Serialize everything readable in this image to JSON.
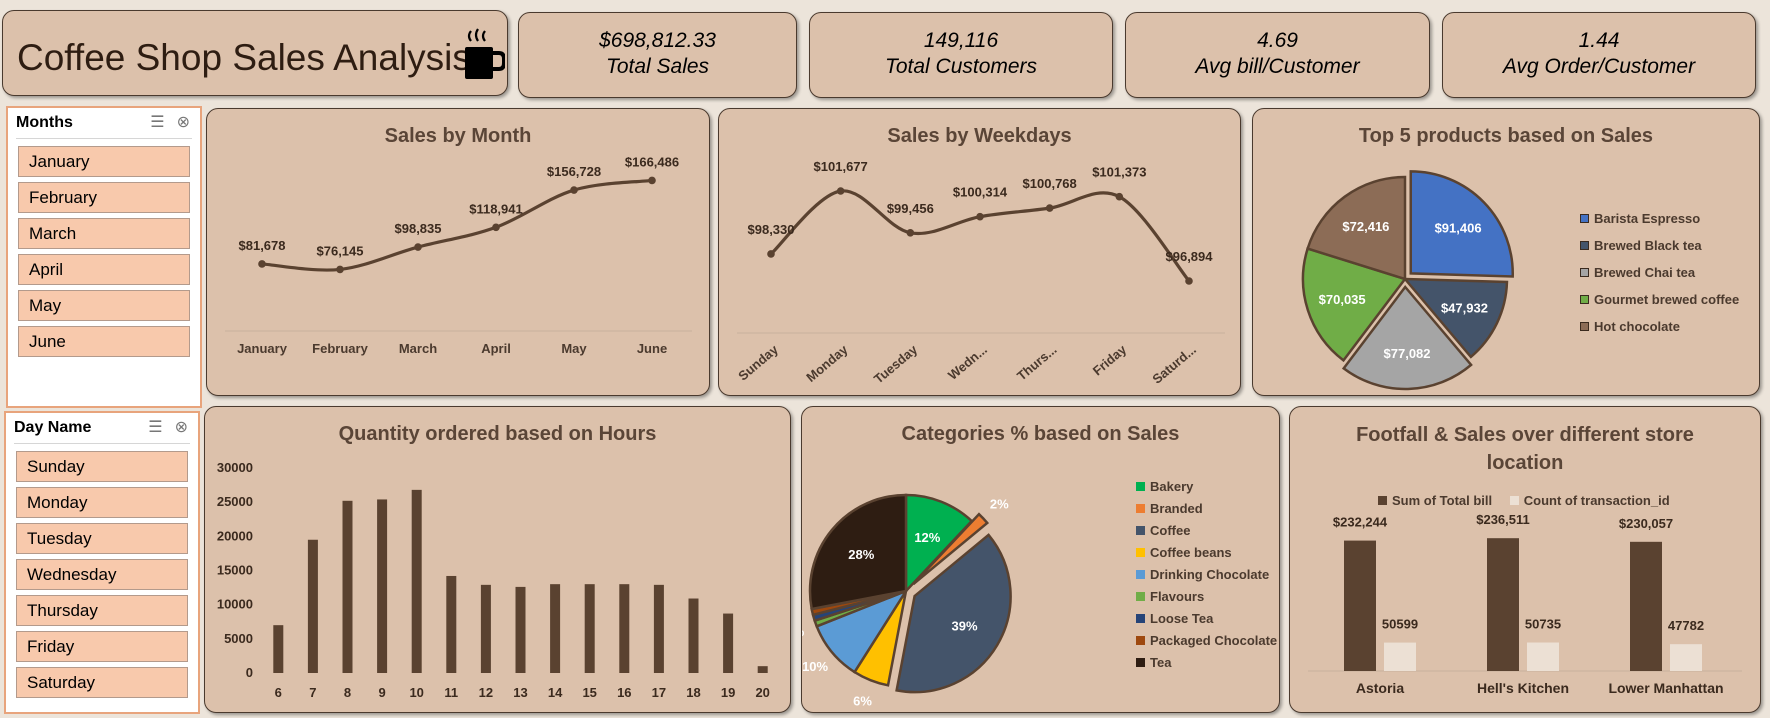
{
  "title": "Coffee Shop Sales Analysis",
  "kpis": [
    {
      "value": "$698,812.33",
      "label": "Total Sales"
    },
    {
      "value": "149,116",
      "label": "Total Customers"
    },
    {
      "value": "4.69",
      "label": "Avg bill/Customer"
    },
    {
      "value": "1.44",
      "label": "Avg Order/Customer"
    }
  ],
  "slicers": {
    "months": {
      "title": "Months",
      "items": [
        "January",
        "February",
        "March",
        "April",
        "May",
        "June"
      ]
    },
    "days": {
      "title": "Day Name",
      "items": [
        "Sunday",
        "Monday",
        "Tuesday",
        "Wednesday",
        "Thursday",
        "Friday",
        "Saturday"
      ]
    }
  },
  "colors": {
    "line": "#5a4230",
    "bar": "#5a4230",
    "bar_light": "#ece0d4",
    "card": "#dcc1ab"
  },
  "chart_data": [
    {
      "id": "month",
      "type": "line",
      "title": "Sales by Month",
      "categories": [
        "January",
        "February",
        "March",
        "April",
        "May",
        "June"
      ],
      "values": [
        81678,
        76145,
        98835,
        118941,
        156728,
        166486
      ],
      "labels": [
        "$81,678",
        "$76,145",
        "$98,835",
        "$118,941",
        "$156,728",
        "$166,486"
      ]
    },
    {
      "id": "weekday",
      "type": "line",
      "title": "Sales by Weekdays",
      "categories": [
        "Sunday",
        "Monday",
        "Tuesday",
        "Wedn...",
        "Thurs...",
        "Friday",
        "Saturd..."
      ],
      "values": [
        98330,
        101677,
        99456,
        100314,
        100768,
        101373,
        96894
      ],
      "labels": [
        "$98,330",
        "$101,677",
        "$99,456",
        "$100,314",
        "$100,768",
        "$101,373",
        "$96,894"
      ]
    },
    {
      "id": "top5",
      "type": "pie",
      "title": "Top 5 products based on Sales",
      "categories": [
        "Barista Espresso",
        "Brewed Black tea",
        "Brewed Chai tea",
        "Gourmet brewed coffee",
        "Hot chocolate"
      ],
      "values": [
        91406,
        47932,
        77082,
        70035,
        72416
      ],
      "labels": [
        "$91,406",
        "$47,932",
        "$77,082",
        "$70,035",
        "$72,416"
      ],
      "colors": [
        "#4472c4",
        "#44546a",
        "#a5a5a5",
        "#70ad47",
        "#8c6c56"
      ]
    },
    {
      "id": "hours",
      "type": "bar",
      "title": "Quantity ordered based on Hours",
      "categories": [
        "6",
        "7",
        "8",
        "9",
        "10",
        "11",
        "12",
        "13",
        "14",
        "15",
        "16",
        "17",
        "18",
        "19",
        "20"
      ],
      "values": [
        7000,
        19500,
        25200,
        25400,
        26800,
        14200,
        12900,
        12600,
        13000,
        13000,
        13000,
        12900,
        10900,
        8700,
        1000
      ],
      "ylim": [
        0,
        30000
      ],
      "yticks": [
        "0",
        "5000",
        "10000",
        "15000",
        "20000",
        "25000",
        "30000"
      ]
    },
    {
      "id": "categories",
      "type": "pie",
      "title": "Categories % based on Sales",
      "categories": [
        "Bakery",
        "Branded",
        "Coffee",
        "Coffee beans",
        "Drinking Chocolate",
        "Flavours",
        "Loose Tea",
        "Packaged Chocolate",
        "Tea"
      ],
      "values": [
        12,
        2,
        39,
        6,
        10,
        1,
        1,
        1,
        28
      ],
      "labels": [
        "12%",
        "2%",
        "39%",
        "6%",
        "10%",
        "1%",
        "1%",
        "1%",
        "28%"
      ],
      "colors": [
        "#00b050",
        "#ed7d31",
        "#44546a",
        "#ffc000",
        "#5b9bd5",
        "#70ad47",
        "#264478",
        "#9e480e",
        "#2e1d12"
      ]
    },
    {
      "id": "footfall",
      "type": "bar",
      "title": "Footfall & Sales over different store location",
      "categories": [
        "Astoria",
        "Hell's Kitchen",
        "Lower Manhattan"
      ],
      "series": [
        {
          "name": "Sum of Total bill",
          "values": [
            232244,
            236511,
            230057
          ],
          "labels": [
            "$232,244",
            "$236,511",
            "$230,057"
          ]
        },
        {
          "name": "Count of transaction_id",
          "values": [
            50599,
            50735,
            47782
          ],
          "labels": [
            "50599",
            "50735",
            "47782"
          ]
        }
      ]
    }
  ]
}
